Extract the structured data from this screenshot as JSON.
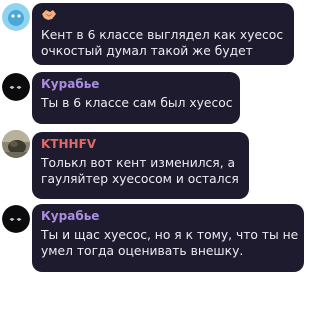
{
  "messages": [
    {
      "sender": "",
      "sender_icon": "handshake-emoji-icon",
      "sender_color": "#e8a37a",
      "avatar": "light-blue-avatar",
      "lines": [
        "Кент в 6 классе выглядел как хуесос",
        "очкостый думал такой же будет"
      ]
    },
    {
      "sender": "Курабье",
      "sender_color": "#a98ee0",
      "avatar": "dark-avatar",
      "lines": [
        "Ты в 6 классе сам был хуесос"
      ]
    },
    {
      "sender": "KTHHFV",
      "sender_color": "#e06a6a",
      "avatar": "photo-avatar",
      "lines": [
        "Толькл вот кент изменился, а",
        "гауляйтер хуесосом и остался"
      ]
    },
    {
      "sender": "Курабье",
      "sender_color": "#a98ee0",
      "avatar": "dark-avatar",
      "lines": [
        "Ты и щас хуесос, но я к тому, что ты не",
        "умел тогда оценивать внешку."
      ]
    }
  ]
}
